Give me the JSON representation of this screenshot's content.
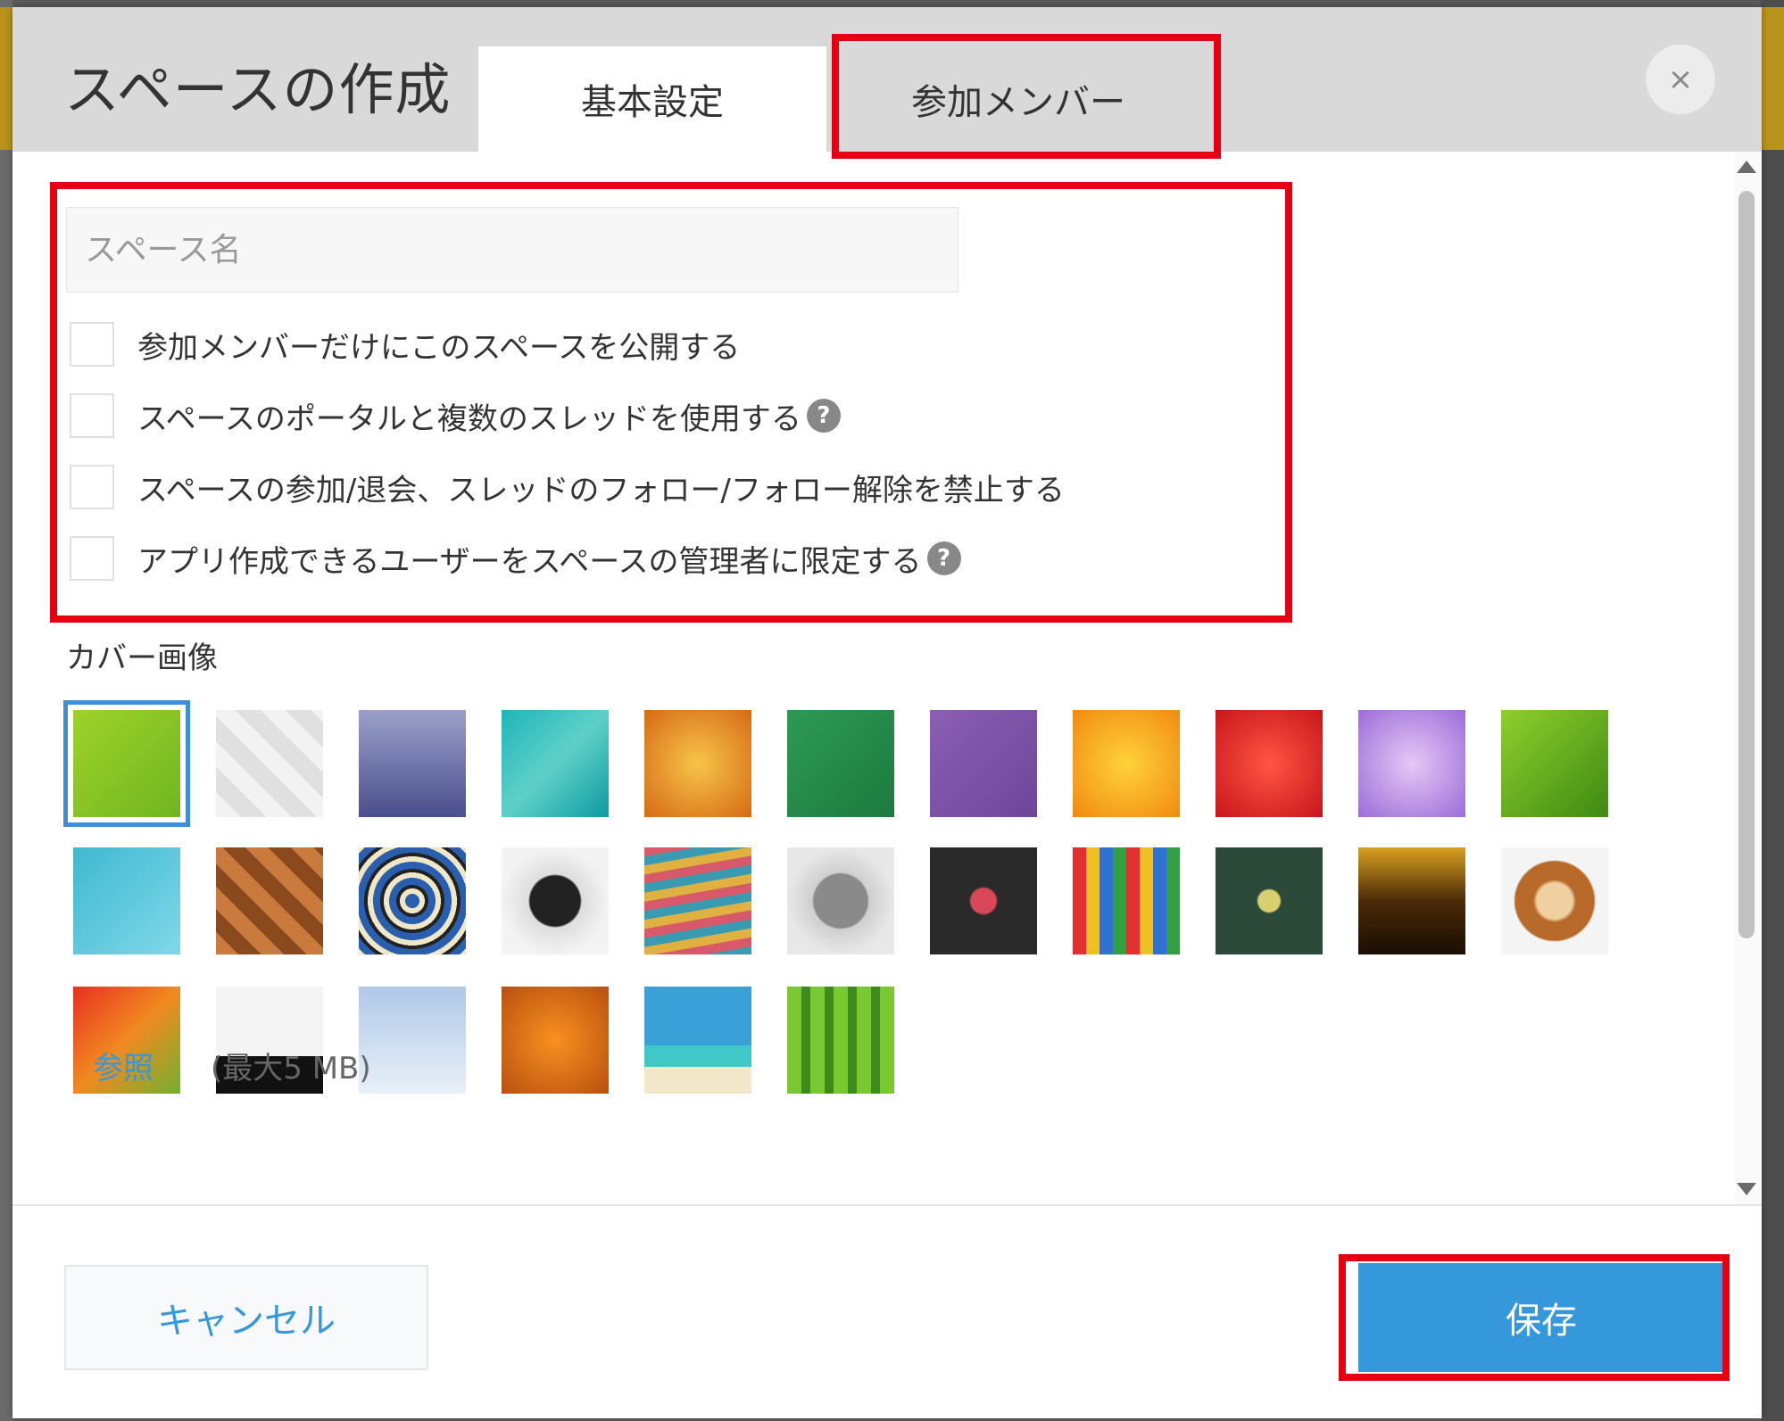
{
  "dialog": {
    "title": "スペースの作成",
    "tabs": [
      {
        "label": "基本設定",
        "active": true
      },
      {
        "label": "参加メンバー",
        "active": false
      }
    ],
    "close_label": "×"
  },
  "form": {
    "space_name_placeholder": "スペース名",
    "space_name_value": "",
    "options": [
      {
        "label": "参加メンバーだけにこのスペースを公開する",
        "checked": false,
        "help": false
      },
      {
        "label": "スペースのポータルと複数のスレッドを使用する",
        "checked": false,
        "help": true
      },
      {
        "label": "スペースの参加/退会、スレッドのフォロー/フォロー解除を禁止する",
        "checked": false,
        "help": false
      },
      {
        "label": "アプリ作成できるユーザーをスペースの管理者に限定する",
        "checked": false,
        "help": true
      }
    ],
    "help_icon": "?"
  },
  "cover": {
    "label": "カバー画像",
    "selected_index": 0,
    "images": [
      "green-abstract",
      "white-diamonds",
      "lavender-gradient",
      "teal-paint",
      "orange-grunge",
      "green-felt",
      "purple-paper",
      "orange-lily",
      "red-carnation",
      "lilac-flower",
      "green-leaf",
      "blue-cubes",
      "wood-weave",
      "mosaic-tiles",
      "compass",
      "notebooks",
      "gear-blueprint",
      "chalk-doodles",
      "crayon-faces",
      "lightbulb-chalkboard",
      "dark-gold-gradient",
      "latte-art",
      "vegetables",
      "cat-dog",
      "snowy-trees",
      "pumpkins",
      "palm-beach",
      "bamboo"
    ],
    "browse_label": "参照",
    "max_size": "(最大5 MB)"
  },
  "footer": {
    "cancel_label": "キャンセル",
    "save_label": "保存"
  },
  "colors": {
    "accent": "#3498db",
    "annotation": "#e60012",
    "header_bg": "#d9d9d9"
  }
}
